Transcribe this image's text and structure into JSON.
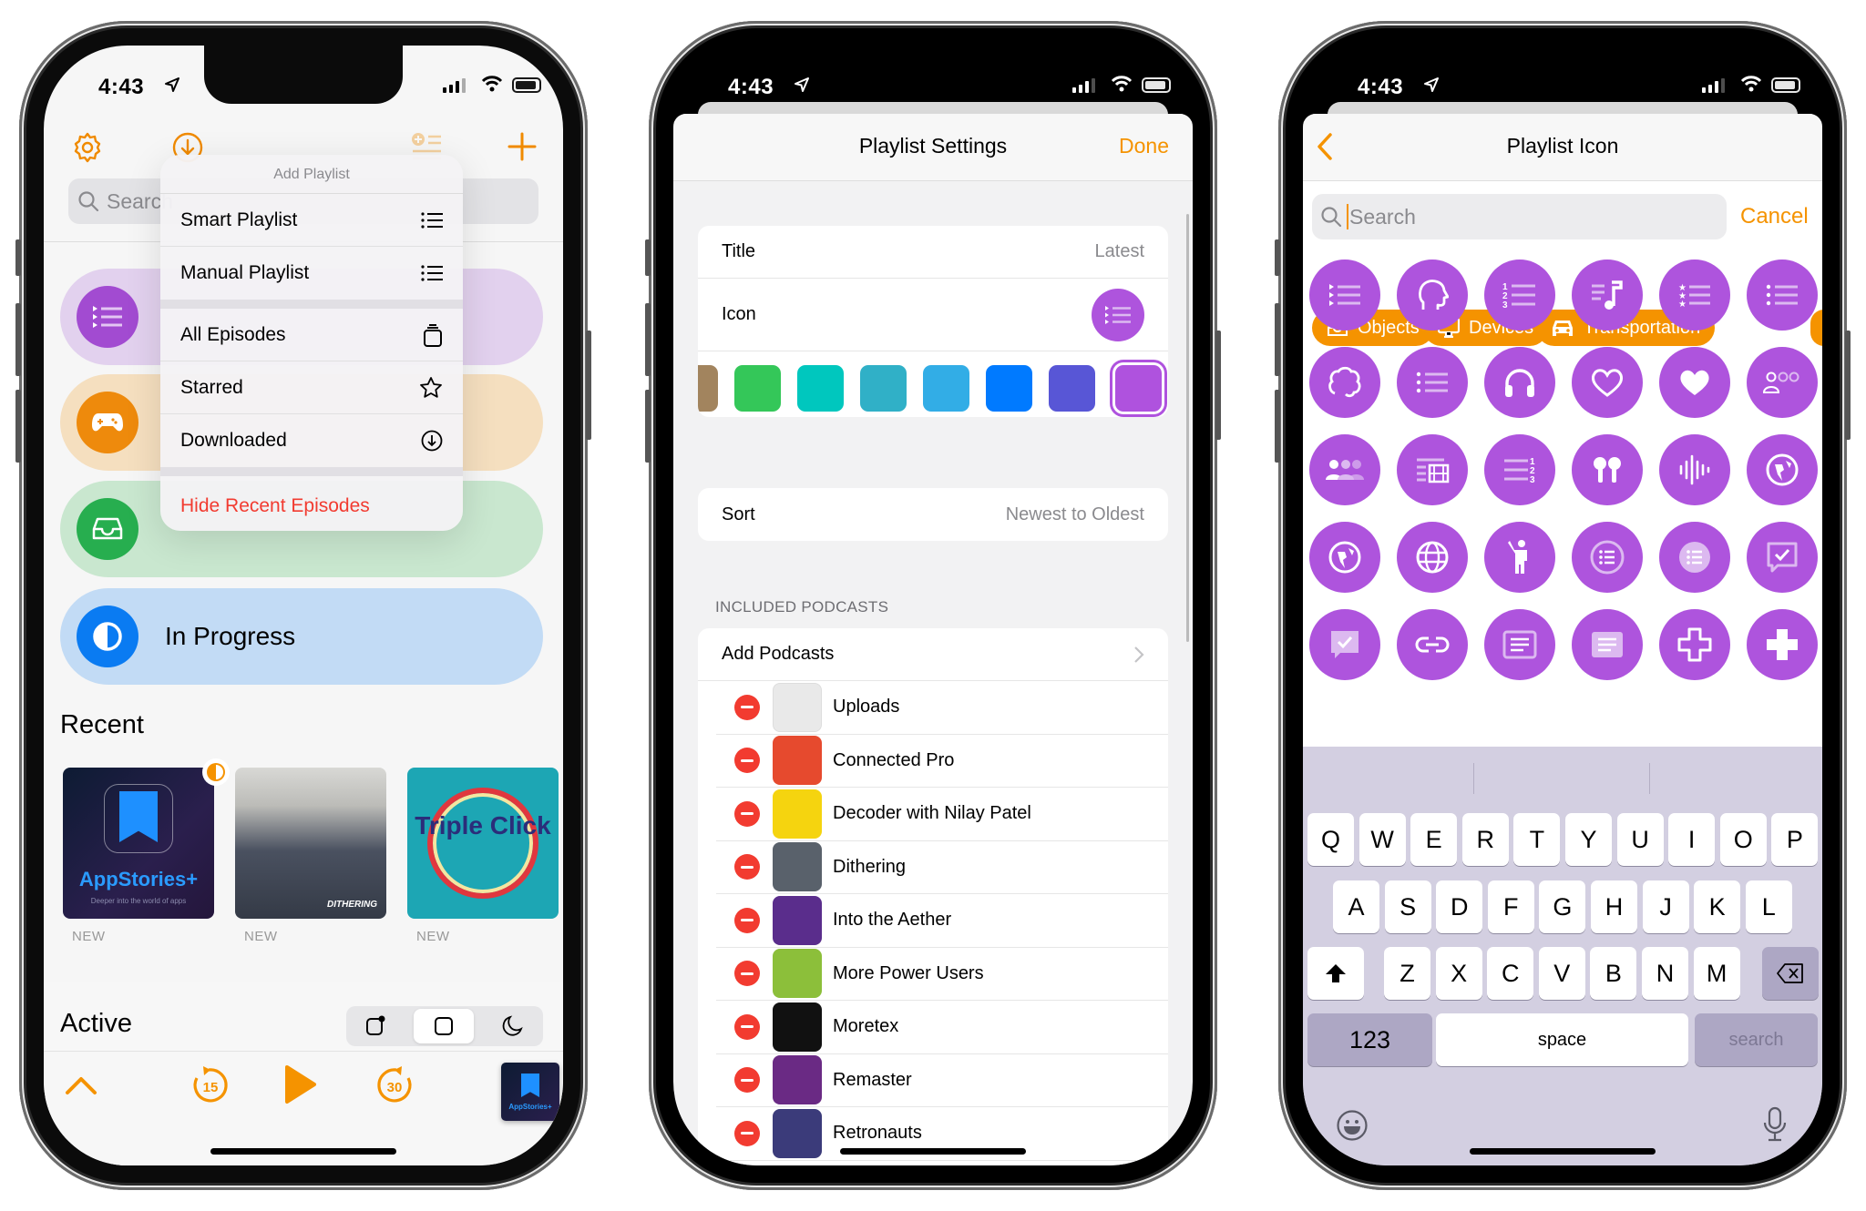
{
  "status_bar": {
    "time": "4:43"
  },
  "phone1": {
    "toolbar": {
      "settings": "gear-icon",
      "download": "download-circle-icon",
      "add_list": "add-list-icon",
      "add": "plus-icon"
    },
    "search_placeholder": "Search",
    "menu": {
      "title": "Add Playlist",
      "items": [
        {
          "label": "Smart Playlist",
          "icon": "list-icon"
        },
        {
          "label": "Manual Playlist",
          "icon": "list-icon"
        },
        {
          "label": "All Episodes",
          "icon": "stack-icon"
        },
        {
          "label": "Starred",
          "icon": "star-icon"
        },
        {
          "label": "Downloaded",
          "icon": "download-circle-icon"
        }
      ],
      "destructive": "Hide Recent Episodes"
    },
    "playlists": [
      {
        "color": "#a24bd1",
        "bg": "#e2d1ee",
        "icon": "playlist-icon"
      },
      {
        "color": "#ee8a0c",
        "bg": "#f5dfbf",
        "icon": "gamecontroller-icon"
      },
      {
        "color": "#27ae4f",
        "bg": "#c9e7cf",
        "icon": "tray-icon"
      },
      {
        "label": "In Progress",
        "color": "#0a7bf2",
        "bg": "#c2dbf5",
        "icon": "half-circle-icon"
      }
    ],
    "recent": {
      "heading": "Recent",
      "items": [
        {
          "name": "AppStories+",
          "subtitle": "Deeper into the world of apps",
          "badge": "NEW"
        },
        {
          "name": "DITHERING",
          "badge": "NEW"
        },
        {
          "name": "Triple Click",
          "badge": "NEW"
        }
      ]
    },
    "active": {
      "heading": "Active",
      "segments": [
        "notification-icon",
        "square-icon",
        "moon-icon"
      ],
      "selected_segment": 1
    },
    "player": {
      "skip_back": "15",
      "skip_forward": "30",
      "now_playing": "AppStories+"
    }
  },
  "phone2": {
    "title": "Playlist Settings",
    "done": "Done",
    "title_row": {
      "label": "Title",
      "value": "Latest"
    },
    "icon_row": {
      "label": "Icon"
    },
    "colors": [
      "#a2845e",
      "#34c759",
      "#00c7be",
      "#30b0c7",
      "#32ade6",
      "#007aff",
      "#5856d6",
      "#af52de"
    ],
    "selected_color": "#af52de",
    "sort_row": {
      "label": "Sort",
      "value": "Newest to Oldest"
    },
    "section_header": "INCLUDED PODCASTS",
    "add_podcasts": "Add Podcasts",
    "podcasts": [
      {
        "name": "Uploads",
        "art": "#e9e9e9"
      },
      {
        "name": "Connected Pro",
        "art": "#e64a2e"
      },
      {
        "name": "Decoder with Nilay Patel",
        "art": "#f5d40f"
      },
      {
        "name": "Dithering",
        "art": "#59616b"
      },
      {
        "name": "Into the Aether",
        "art": "#5a2d8c"
      },
      {
        "name": "More Power Users",
        "art": "#8cbf3a"
      },
      {
        "name": "Moretex",
        "art": "#111111"
      },
      {
        "name": "Remaster",
        "art": "#6a2a84"
      },
      {
        "name": "Retronauts",
        "art": "#3b3b7a"
      }
    ]
  },
  "phone3": {
    "title": "Playlist Icon",
    "search_placeholder": "Search",
    "cancel": "Cancel",
    "categories": [
      {
        "label": "Objects",
        "icon": "tray-icon"
      },
      {
        "label": "Devices",
        "icon": "desktop-icon"
      },
      {
        "label": "Transportation",
        "icon": "car-icon"
      }
    ],
    "icons": [
      "play-list-icon",
      "brain-head-icon",
      "numbered-list-icon",
      "music-list-icon",
      "star-list-icon",
      "list-icon",
      "brain-icon",
      "bullet-list-icon",
      "headphones-icon",
      "heart-outline-icon",
      "heart-fill-icon",
      "people-outline-icon",
      "people-fill-icon",
      "film-list-icon",
      "numbered-list-right-icon",
      "airpods-icon",
      "waveform-icon",
      "globe-africa-outline-icon",
      "globe-africa-fill-icon",
      "globe-grid-icon",
      "person-wave-icon",
      "list-circle-outline-icon",
      "list-circle-fill-icon",
      "checkmark-bubble-outline-icon",
      "checkmark-bubble-fill-icon",
      "link-icon",
      "list-rect-outline-icon",
      "list-rect-fill-icon",
      "cross-outline-icon",
      "cross-fill-icon"
    ],
    "keyboard": {
      "rows": [
        [
          "Q",
          "W",
          "E",
          "R",
          "T",
          "Y",
          "U",
          "I",
          "O",
          "P"
        ],
        [
          "A",
          "S",
          "D",
          "F",
          "G",
          "H",
          "J",
          "K",
          "L"
        ],
        [
          "Z",
          "X",
          "C",
          "V",
          "B",
          "N",
          "M"
        ]
      ],
      "numbers": "123",
      "space": "space",
      "action": "search"
    }
  },
  "colors": {
    "accent": "#f08a00",
    "purple": "#ae54dd",
    "destructive": "#f23b30"
  }
}
